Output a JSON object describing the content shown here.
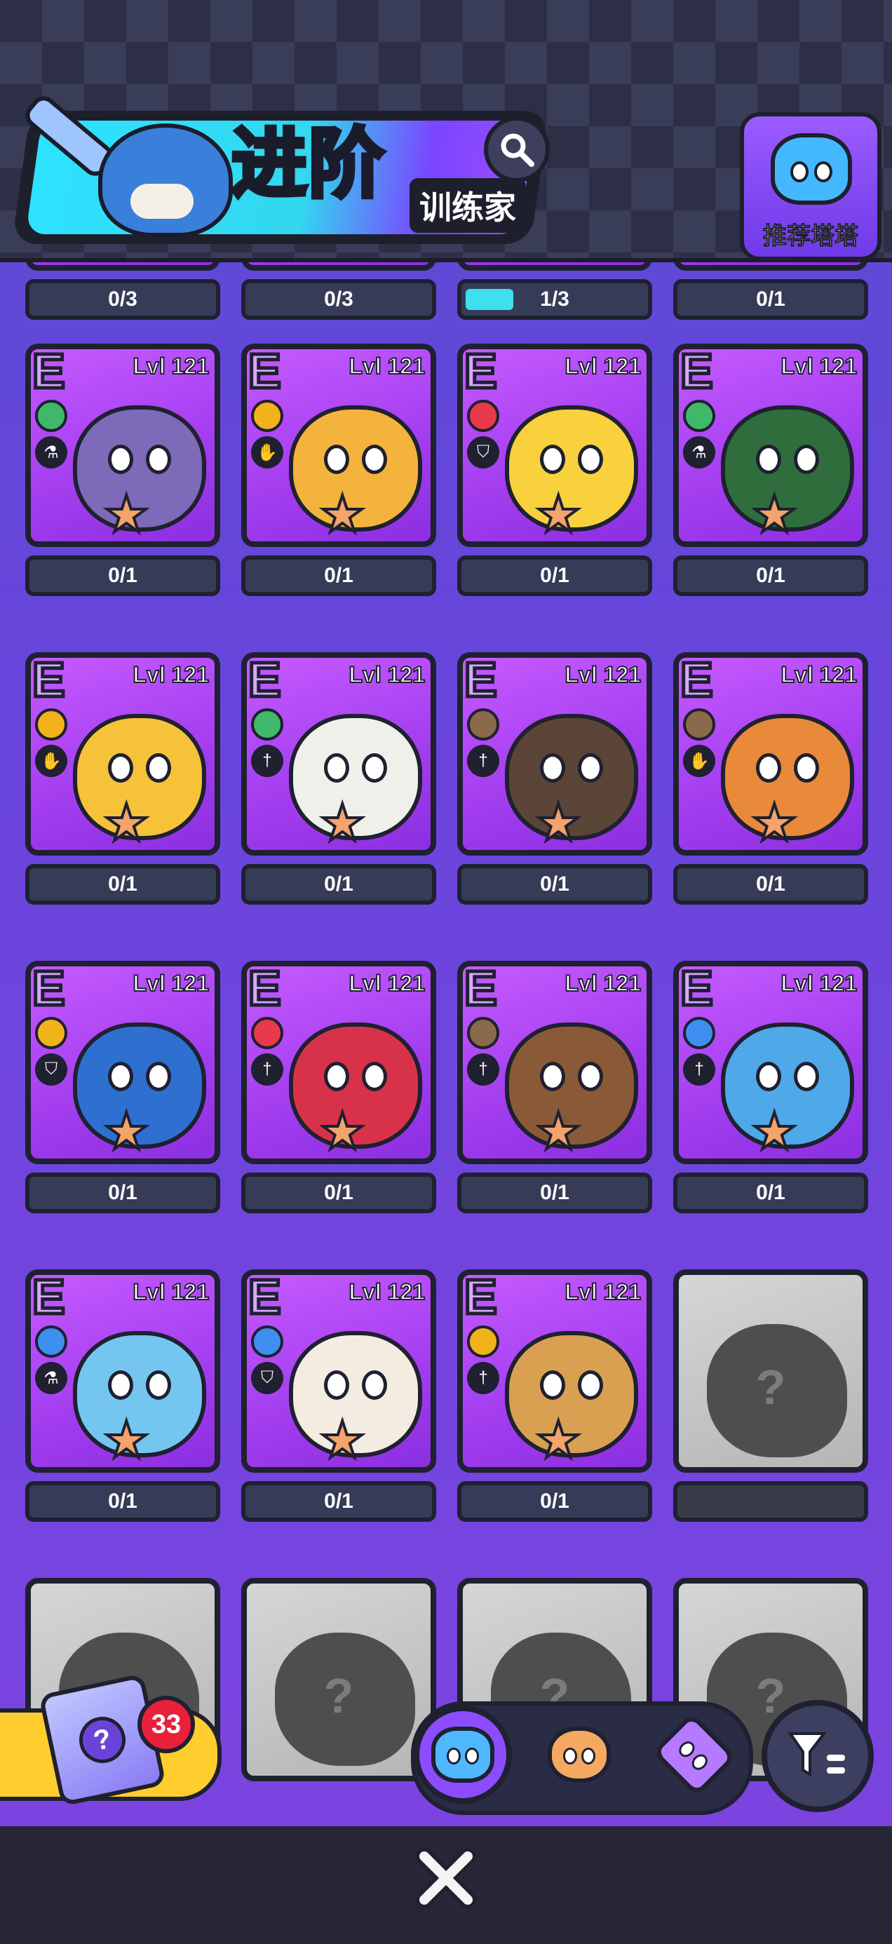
{
  "header": {
    "title": "进阶",
    "subtitle": "训练家",
    "recommend_label": "推荐塔塔"
  },
  "top_partial_bars": [
    "0/3",
    "0/3",
    "1/3",
    "0/1"
  ],
  "rows": [
    [
      {
        "tier": "E",
        "level": "Lvl 121",
        "element": "grass",
        "role": "potion",
        "progress": "0/1",
        "color": "#7d6ab8"
      },
      {
        "tier": "E",
        "level": "Lvl 121",
        "element": "electric",
        "role": "hand",
        "progress": "0/1",
        "color": "#f4b33c"
      },
      {
        "tier": "E",
        "level": "Lvl 121",
        "element": "fire",
        "role": "shield",
        "progress": "0/1",
        "color": "#f8d13c"
      },
      {
        "tier": "E",
        "level": "Lvl 121",
        "element": "grass",
        "role": "potion",
        "progress": "0/1",
        "color": "#2f6e3c"
      }
    ],
    [
      {
        "tier": "E",
        "level": "Lvl 121",
        "element": "electric",
        "role": "hand",
        "progress": "0/1",
        "color": "#f5c23a"
      },
      {
        "tier": "E",
        "level": "Lvl 121",
        "element": "grass",
        "role": "sword",
        "progress": "0/1",
        "color": "#f0f0ea"
      },
      {
        "tier": "E",
        "level": "Lvl 121",
        "element": "earth",
        "role": "sword",
        "progress": "0/1",
        "color": "#5a4538"
      },
      {
        "tier": "E",
        "level": "Lvl 121",
        "element": "earth",
        "role": "hand",
        "progress": "0/1",
        "color": "#e88a3a"
      }
    ],
    [
      {
        "tier": "E",
        "level": "Lvl 121",
        "element": "electric",
        "role": "shield",
        "progress": "0/1",
        "color": "#2e6fd0"
      },
      {
        "tier": "E",
        "level": "Lvl 121",
        "element": "fire",
        "role": "sword",
        "progress": "0/1",
        "color": "#d8324a"
      },
      {
        "tier": "E",
        "level": "Lvl 121",
        "element": "earth",
        "role": "sword",
        "progress": "0/1",
        "color": "#8a5a38"
      },
      {
        "tier": "E",
        "level": "Lvl 121",
        "element": "water",
        "role": "sword",
        "progress": "0/1",
        "color": "#4fa8e8"
      }
    ],
    [
      {
        "tier": "E",
        "level": "Lvl 121",
        "element": "water",
        "role": "potion",
        "progress": "0/1",
        "color": "#74c6f0"
      },
      {
        "tier": "E",
        "level": "Lvl 121",
        "element": "water",
        "role": "shield",
        "progress": "0/1",
        "color": "#f4ece0"
      },
      {
        "tier": "E",
        "level": "Lvl 121",
        "element": "electric",
        "role": "sword",
        "progress": "0/1",
        "color": "#d8a050"
      },
      {
        "locked": true,
        "qmark": "?"
      }
    ],
    [
      {
        "locked": true,
        "qmark": "?"
      },
      {
        "locked": true,
        "qmark": "?"
      },
      {
        "locked": true,
        "qmark": "?"
      },
      {
        "locked": true,
        "qmark": "?"
      }
    ]
  ],
  "element_colors": {
    "grass": "#3fb86a",
    "electric": "#f2b21c",
    "fire": "#e83a4a",
    "earth": "#8a6a4a",
    "water": "#3f8ff0"
  },
  "role_glyphs": {
    "potion": "⚗",
    "hand": "✋",
    "shield": "⛉",
    "sword": "†"
  },
  "chest": {
    "count": "33"
  },
  "tabs": [
    {
      "name": "tarta-tab",
      "active": true,
      "color": "#4fb8ff"
    },
    {
      "name": "food-tab",
      "active": false,
      "color": "#f4a860"
    },
    {
      "name": "emblem-tab",
      "active": false,
      "color": "#b57aff"
    }
  ],
  "close_label": "✕"
}
